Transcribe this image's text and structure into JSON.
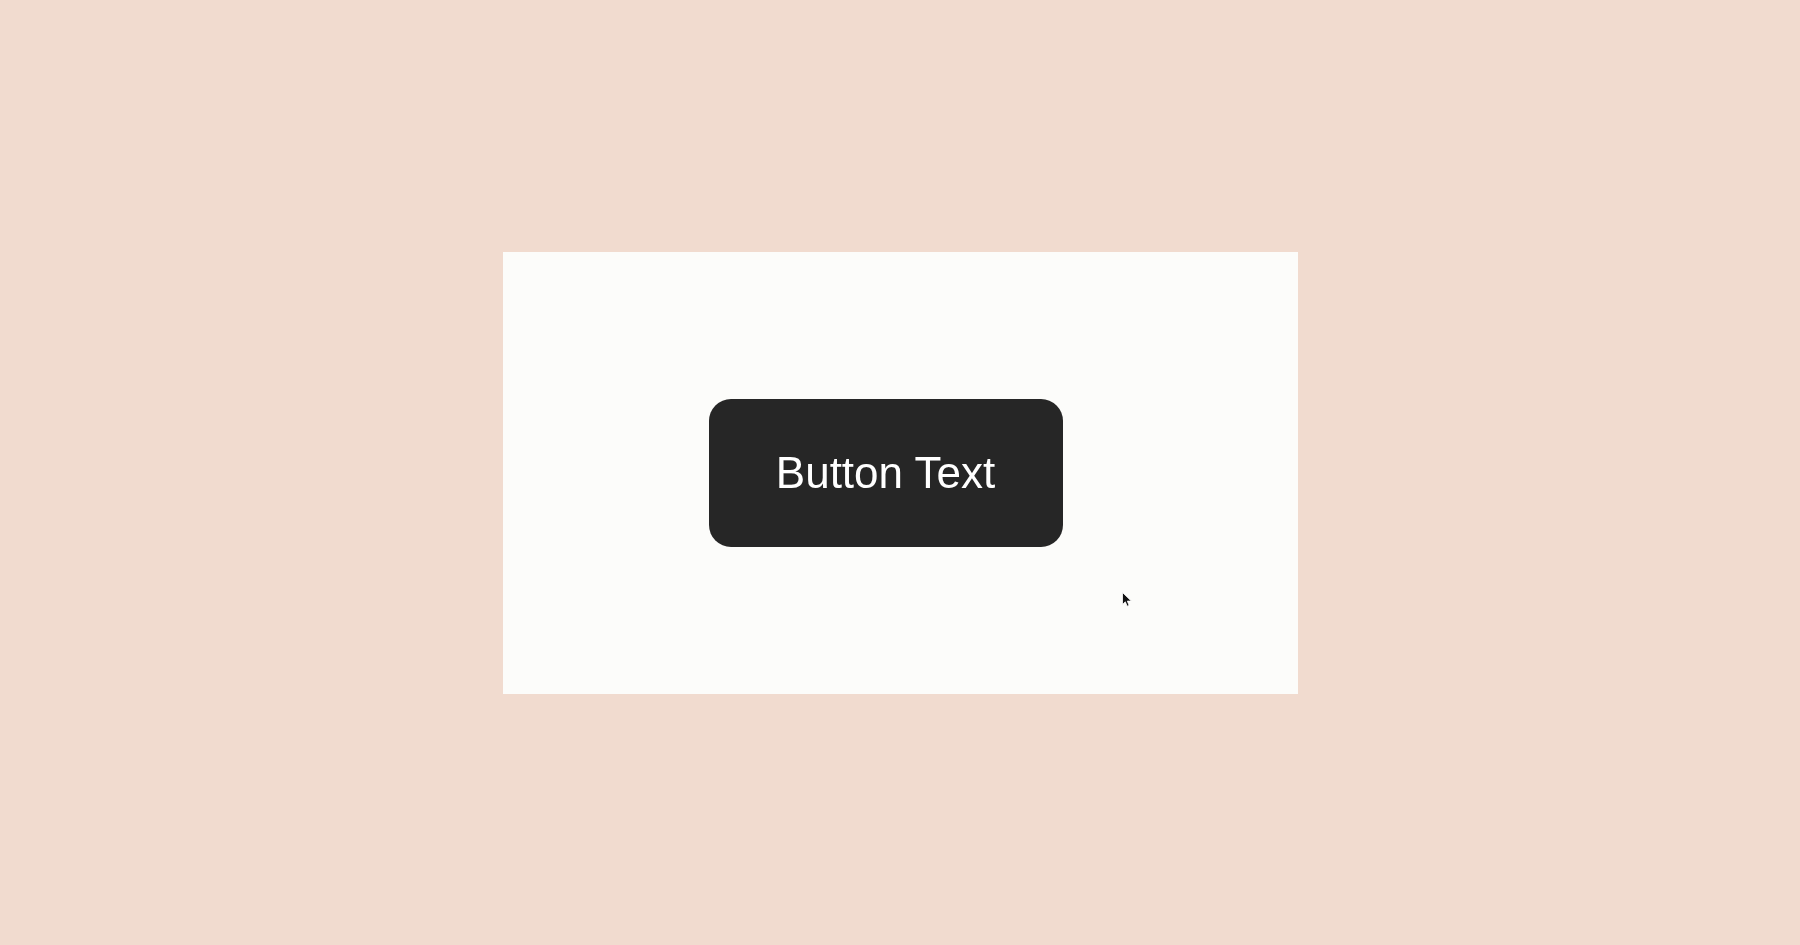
{
  "button": {
    "label": "Button Text"
  }
}
